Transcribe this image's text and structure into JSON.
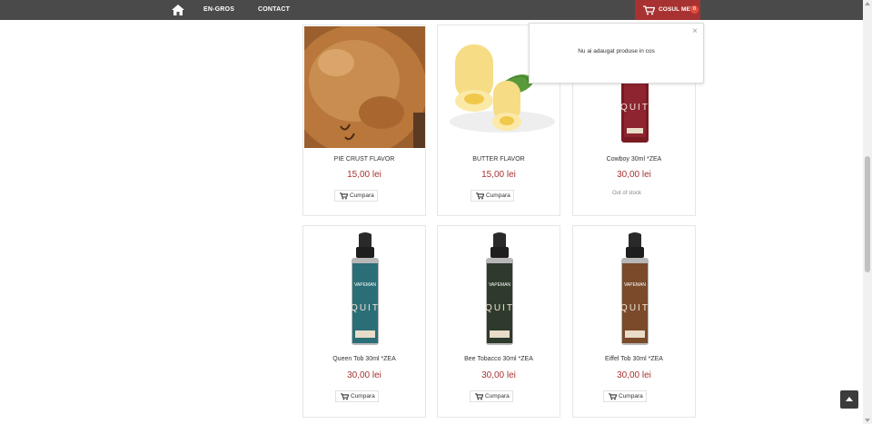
{
  "nav": {
    "home_icon": "home-icon",
    "links": [
      "EN-GROS",
      "CONTACT"
    ],
    "cart_label": "COSUL MEU",
    "cart_count": "0",
    "colors": {
      "bar": "#4a4a4a",
      "cart": "#a83232"
    }
  },
  "cart_popup": {
    "message": "Nu ai adaugat produse in cos",
    "close": "×"
  },
  "products": [
    {
      "name": "PIE CRUST FLAVOR",
      "price": "15,00 lei",
      "button": "Cumpara",
      "image": "pie-crust"
    },
    {
      "name": "BUTTER FLAVOR",
      "price": "15,00 lei",
      "button": "Cumpara",
      "image": "butter"
    },
    {
      "name": "Cowboy 30ml *ZEA",
      "price": "30,00 lei",
      "status": "Out of stock",
      "image": "bottle-red"
    },
    {
      "name": "Queen Tob 30ml *ZEA",
      "price": "30,00 lei",
      "button": "Cumpara",
      "image": "bottle-teal"
    },
    {
      "name": "Bee Tobacco 30ml *ZEA",
      "price": "30,00 lei",
      "button": "Cumpara",
      "image": "bottle-dark"
    },
    {
      "name": "Eiffel Tob 30ml *ZEA",
      "price": "30,00 lei",
      "button": "Cumpara",
      "image": "bottle-brown"
    }
  ],
  "bottle_text": {
    "brand": "VAPEMAN",
    "line": "QUIT"
  }
}
